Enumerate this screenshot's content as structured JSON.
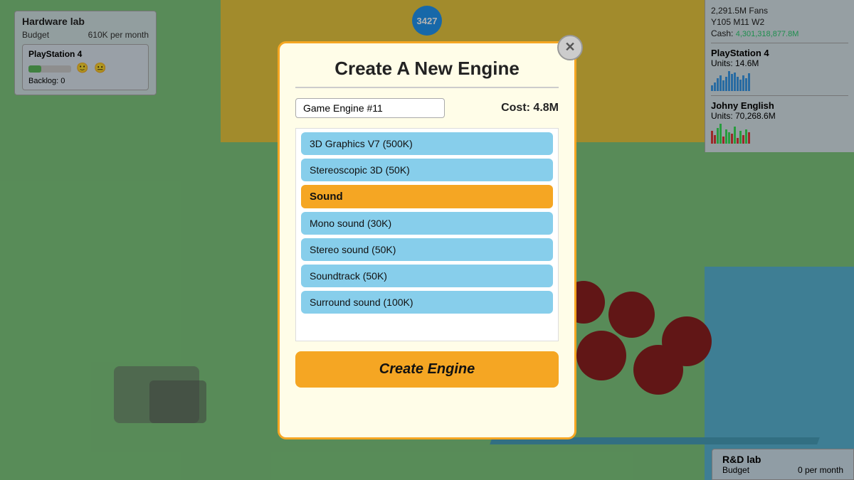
{
  "game": {
    "counter": "3427",
    "hw_lab": {
      "title": "Hardware lab",
      "budget_label": "Budget",
      "budget_value": "610K per month",
      "platform": "PlayStation 4",
      "backlog_label": "Backlog:",
      "backlog_value": "0"
    },
    "stats": {
      "fans": "2,291.5M Fans",
      "date": "Y105 M11 W2",
      "cash_label": "Cash:",
      "cash_value": "4,301,318,877.8M"
    },
    "playstation": {
      "title": "PlayStation 4",
      "units": "Units: 14.6M"
    },
    "johny": {
      "title": "Johny English",
      "units": "Units: 70,268.6M"
    },
    "rd_lab": {
      "title": "R&D lab",
      "budget_label": "Budget",
      "budget_value": "0 per month"
    }
  },
  "modal": {
    "title": "Create A New Engine",
    "close_icon": "✕",
    "name_value": "Game Engine #11",
    "cost_label": "Cost: 4.8M",
    "features": [
      {
        "type": "item",
        "label": "3D Graphics V7 (500K)"
      },
      {
        "type": "item",
        "label": "Stereoscopic 3D (50K)"
      },
      {
        "type": "category",
        "label": "Sound"
      },
      {
        "type": "item",
        "label": "Mono sound (30K)"
      },
      {
        "type": "item",
        "label": "Stereo sound (50K)"
      },
      {
        "type": "item",
        "label": "Soundtrack (50K)"
      },
      {
        "type": "item",
        "label": "Surround sound (100K)"
      }
    ],
    "create_button": "Create Engine"
  }
}
